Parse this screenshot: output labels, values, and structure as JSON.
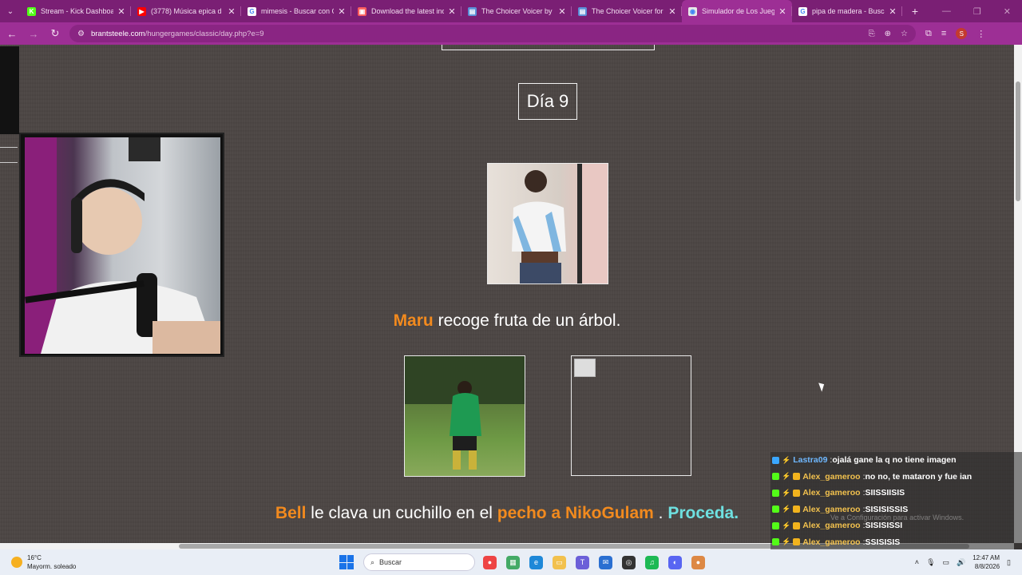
{
  "browser": {
    "tabs": [
      {
        "title": "Stream - Kick Dashboard",
        "favicon_color": "#53fc18",
        "favicon_glyph": "K"
      },
      {
        "title": "(3778) Música epica d",
        "favicon_color": "#ff0000",
        "favicon_glyph": "▶"
      },
      {
        "title": "mimesis - Buscar con Goo",
        "favicon_color": "#ffffff",
        "favicon_glyph": "G"
      },
      {
        "title": "Download the latest indie",
        "favicon_color": "#fa5c5c",
        "favicon_glyph": "▣"
      },
      {
        "title": "The Choicer Voicer by Yer",
        "favicon_color": "#5a8fd8",
        "favicon_glyph": "▤"
      },
      {
        "title": "The Choicer Voicer for Wi",
        "favicon_color": "#5a8fd8",
        "favicon_glyph": "▤"
      },
      {
        "title": "Simulador de Los Juegos",
        "favicon_color": "#e8e8e8",
        "favicon_glyph": "◉"
      },
      {
        "title": "pipa de madera - Buscar",
        "favicon_color": "#ffffff",
        "favicon_glyph": "G"
      }
    ],
    "active_tab_index": 6,
    "url_domain": "brantsteele.com",
    "url_path": "/hungergames/classic/day.php?e=9"
  },
  "page": {
    "day_title": "Día 9",
    "event1": {
      "tribute": "Maru",
      "text": "recoge fruta de un árbol."
    },
    "event2": {
      "tribute1": "Bell",
      "text": "le clava un cuchillo en el",
      "tribute2": "pecho a NikoGulam",
      "separator": ".",
      "proceed": "Proceda."
    }
  },
  "chat": {
    "messages": [
      {
        "user": "Lastra09",
        "text": "ojalá gane la q no tiene imagen",
        "user_color": "#6fb8ff"
      },
      {
        "user": "Alex_gameroo",
        "text": "no no, te mataron y fue ian",
        "user_color": "#f2c14e"
      },
      {
        "user": "Alex_gameroo",
        "text": "SIISSIISIS",
        "user_color": "#f2c14e"
      },
      {
        "user": "Alex_gameroo",
        "text": "SISISISSIS",
        "user_color": "#f2c14e"
      },
      {
        "user": "Alex_gameroo",
        "text": "SISISISSI",
        "user_color": "#f2c14e"
      },
      {
        "user": "Alex_gameroo",
        "text": "SSISISIS",
        "user_color": "#f2c14e"
      }
    ],
    "activate_watermark": "Ve a Configuración para activar Windows."
  },
  "taskbar": {
    "weather_temp": "16°C",
    "weather_desc": "Mayorm. soleado",
    "search_placeholder": "Buscar",
    "time": "12:47 AM",
    "date": "8/8/2026"
  },
  "colors": {
    "tribute": "#f28a1e",
    "proceed": "#6ee0e0",
    "tabstrip": "#7a1f74",
    "toolbar": "#9d2f95"
  }
}
